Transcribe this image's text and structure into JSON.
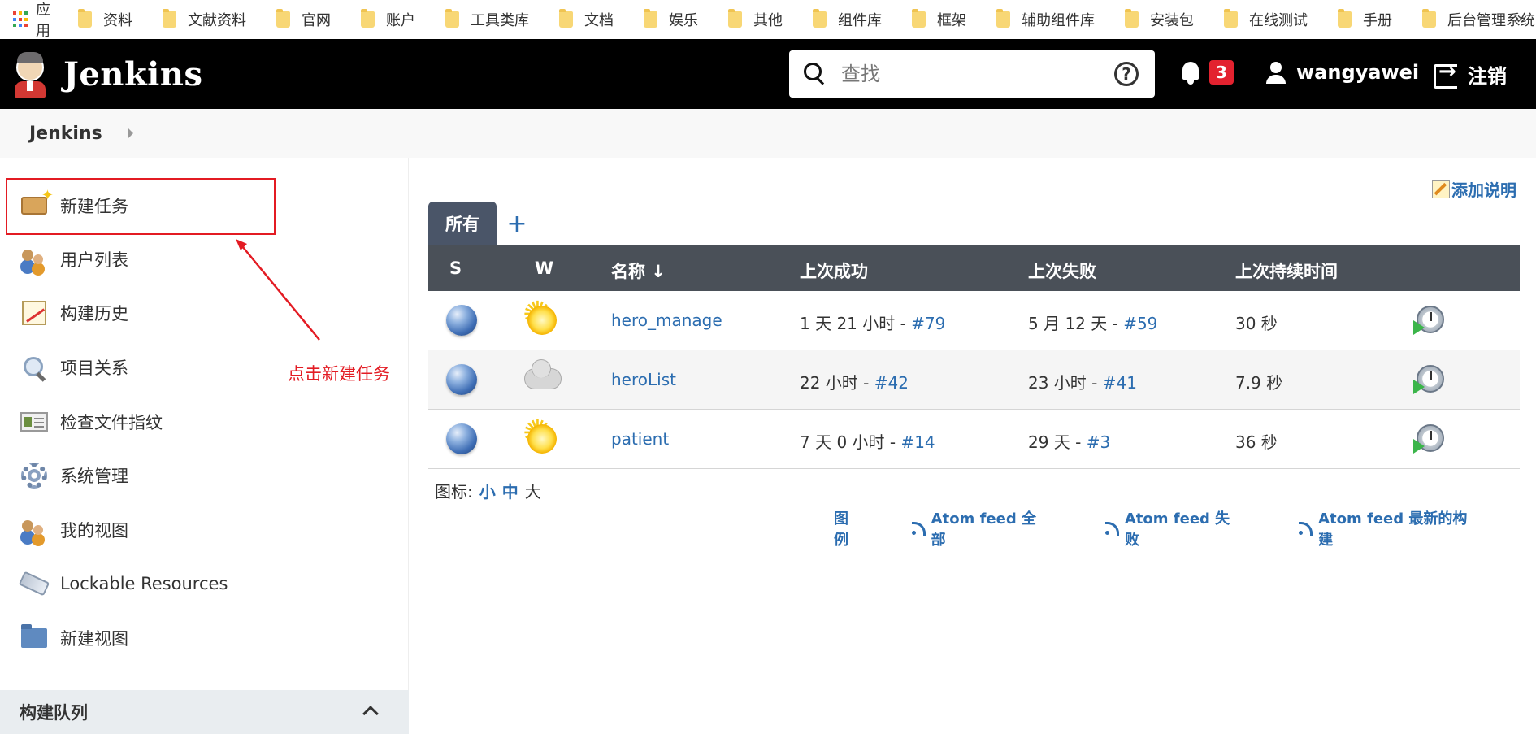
{
  "bookmarks": {
    "apps_label": "应用",
    "items": [
      "资料",
      "文献资料",
      "官网",
      "账户",
      "工具类库",
      "文档",
      "娱乐",
      "其他",
      "组件库",
      "框架",
      "辅助组件库",
      "安装包",
      "在线测试",
      "手册",
      "后台管理系统"
    ],
    "more": "»"
  },
  "header": {
    "brand": "Jenkins",
    "search_placeholder": "查找",
    "help": "?",
    "notification_count": "3",
    "username": "wangyawei",
    "logout_label": "注销"
  },
  "breadcrumb": {
    "root": "Jenkins"
  },
  "sidebar": {
    "tasks": [
      {
        "label": "新建任务",
        "icon": "new-item-box-icon"
      },
      {
        "label": "用户列表",
        "icon": "people-icon"
      },
      {
        "label": "构建历史",
        "icon": "notepad-icon"
      },
      {
        "label": "项目关系",
        "icon": "magnifier-icon"
      },
      {
        "label": "检查文件指纹",
        "icon": "fingerprint-card-icon"
      },
      {
        "label": "系统管理",
        "icon": "gear-icon"
      },
      {
        "label": "我的视图",
        "icon": "people-icon"
      },
      {
        "label": "Lockable Resources",
        "icon": "usb-icon"
      },
      {
        "label": "新建视图",
        "icon": "folder-icon"
      }
    ],
    "queue_label": "构建队列",
    "annotation": "点击新建任务"
  },
  "main": {
    "add_description": "添加说明",
    "tab_all": "所有",
    "tab_add": "+",
    "columns": [
      "S",
      "W",
      "名称 ↓",
      "上次成功",
      "上次失败",
      "上次持续时间"
    ],
    "jobs": [
      {
        "name": "hero_manage",
        "weather": "sunny-icon",
        "last_success": "1 天 21 小时 - ",
        "last_success_build": "#79",
        "last_failure": "5 月 12 天 - ",
        "last_failure_build": "#59",
        "duration": "30 秒"
      },
      {
        "name": "heroList",
        "weather": "cloudy-icon",
        "last_success": "22 小时 - ",
        "last_success_build": "#42",
        "last_failure": "23 小时 - ",
        "last_failure_build": "#41",
        "duration": "7.9 秒"
      },
      {
        "name": "patient",
        "weather": "sunny-icon",
        "last_success": "7 天 0 小时 - ",
        "last_success_build": "#14",
        "last_failure": "29 天 - ",
        "last_failure_build": "#3",
        "duration": "36 秒"
      }
    ],
    "icon_size_label": "图标:",
    "icon_sizes": [
      "小",
      "中",
      "大"
    ],
    "legend": "图例",
    "feeds": [
      "Atom feed 全部",
      "Atom feed 失败",
      "Atom feed 最新的构建"
    ]
  },
  "colors": {
    "header_bg": "#000000",
    "link": "#2c6db0",
    "badge": "#e3222f",
    "annotation": "#e31b23",
    "table_header": "#4a5058"
  }
}
